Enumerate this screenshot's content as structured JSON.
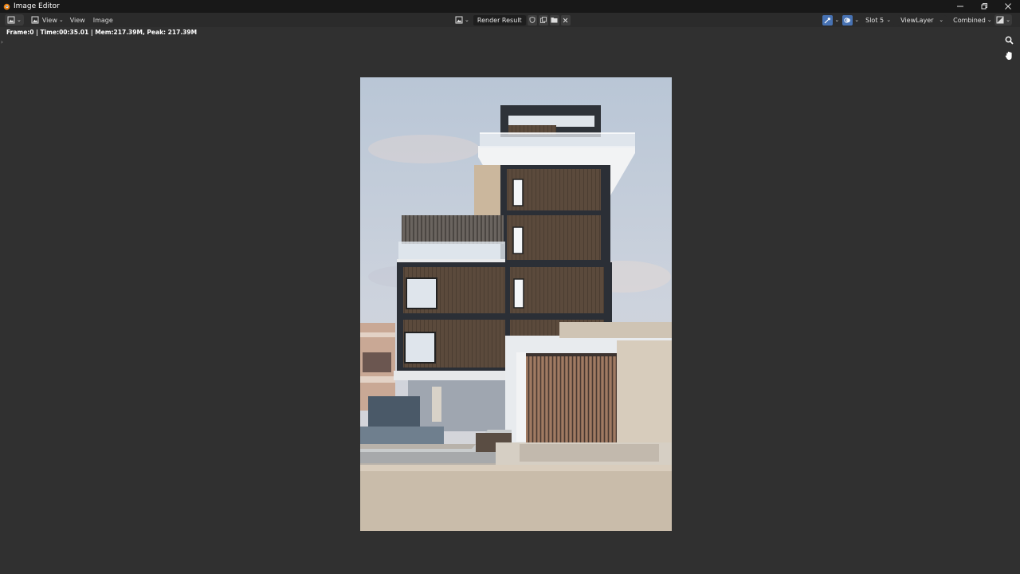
{
  "window": {
    "title": "Image Editor",
    "controls": [
      "minimize-icon",
      "restore-icon",
      "close-icon"
    ]
  },
  "header": {
    "menus": [
      {
        "label": "View"
      },
      {
        "label": "View"
      },
      {
        "label": "Image"
      }
    ],
    "image_name": "Render Result",
    "slot": "Slot 5",
    "view_layer": "ViewLayer",
    "pass": "Combined"
  },
  "status": {
    "render_stats": "Frame:0 | Time:00:35.01 | Mem:217.39M, Peak: 217.39M"
  },
  "colors": {
    "accent": "#4772b3",
    "background": "#303030",
    "header": "#2b2b2b",
    "titlebar": "#181818"
  }
}
